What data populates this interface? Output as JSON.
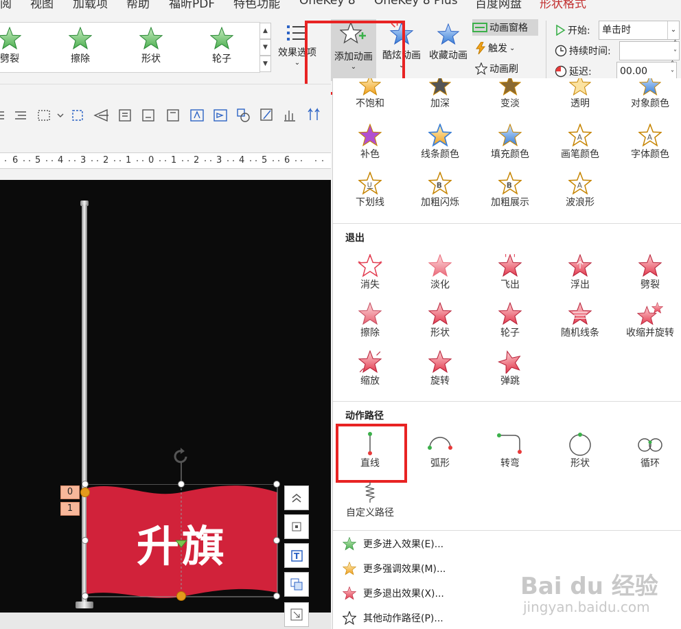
{
  "menubar": {
    "items": [
      "阅",
      "视图",
      "加载项",
      "帮助",
      "福昕PDF",
      "特色功能",
      "OneKey 8",
      "OneKey 8 Plus",
      "百度网盘",
      "形状格式"
    ]
  },
  "ribbon": {
    "gallery": [
      "劈裂",
      "擦除",
      "形状",
      "轮子"
    ],
    "effect_options": "效果选项",
    "add_animation": "添加动画",
    "cool_animation": "酷炫动画",
    "fav_animation": "收藏动画",
    "anim_pane": "动画窗格",
    "trigger": "触发",
    "anim_painter": "动画刷",
    "start_label": "开始:",
    "start_value": "单击时",
    "duration_label": "持续时间:",
    "duration_value": "",
    "delay_label": "延迟:",
    "delay_value": "00.00"
  },
  "ruler": {
    "ticks": [
      "6",
      "5",
      "4",
      "3",
      "2",
      "1",
      "0",
      "1",
      "2",
      "3",
      "4",
      "5",
      "6"
    ]
  },
  "panel": {
    "emphasis_row1": [
      "不饱和",
      "加深",
      "变淡",
      "透明",
      "对象颜色"
    ],
    "emphasis_row2": [
      "补色",
      "线条颜色",
      "填充颜色",
      "画笔颜色",
      "字体颜色"
    ],
    "emphasis_row3": [
      "下划线",
      "加粗闪烁",
      "加粗展示",
      "波浪形"
    ],
    "exit_title": "退出",
    "exit_row1": [
      "消失",
      "淡化",
      "飞出",
      "浮出",
      "劈裂"
    ],
    "exit_row2": [
      "擦除",
      "形状",
      "轮子",
      "随机线条",
      "收缩并旋转"
    ],
    "exit_row3": [
      "缩放",
      "旋转",
      "弹跳"
    ],
    "path_title": "动作路径",
    "paths_row1": [
      "直线",
      "弧形",
      "转弯",
      "形状",
      "循环"
    ],
    "paths_row2": [
      "自定义路径"
    ],
    "more": [
      "更多进入效果(E)...",
      "更多强调效果(M)...",
      "更多退出效果(X)...",
      "其他动作路径(P)..."
    ]
  },
  "slide": {
    "flag_text": "升旗",
    "tag_0": "0",
    "tag_1": "1"
  },
  "watermark": {
    "brand": "Bai du 经验",
    "url": "jingyan.baidu.com"
  },
  "colors": {
    "accent_red": "#e82323",
    "flag": "#d1223a",
    "star_green": "#4caf50",
    "star_red": "#e8455a"
  }
}
